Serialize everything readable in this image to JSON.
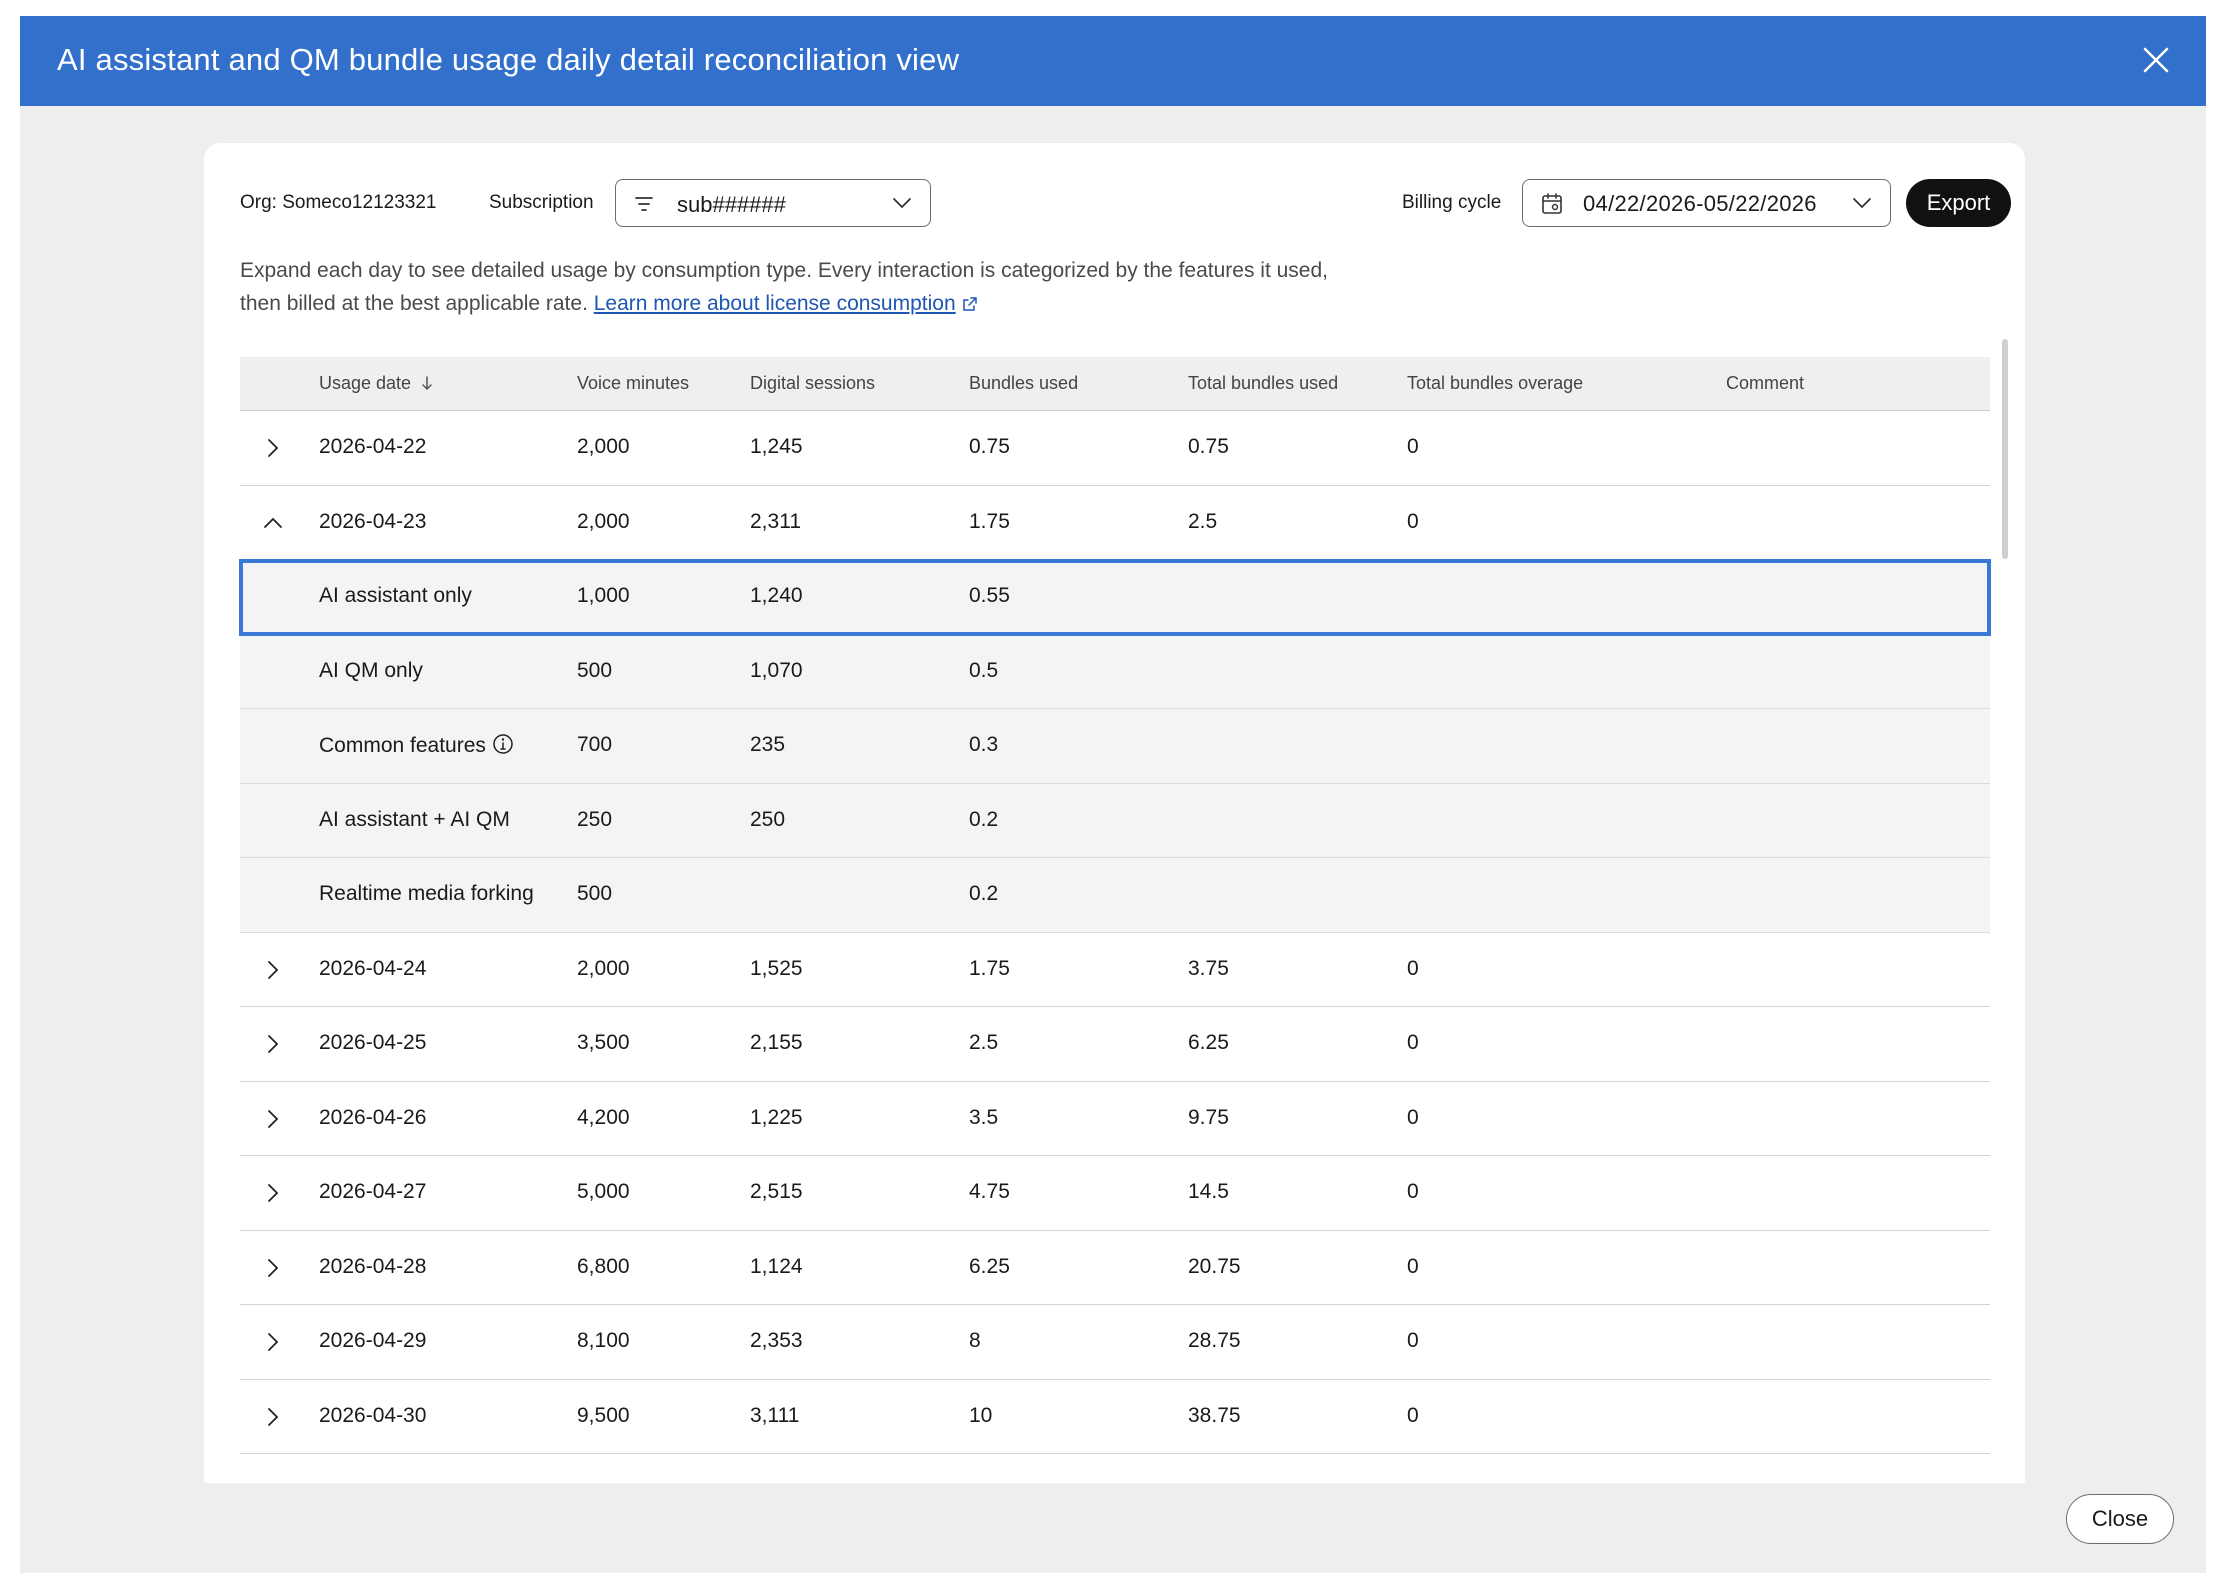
{
  "header": {
    "title": "AI assistant and QM bundle usage daily detail reconciliation view"
  },
  "filters": {
    "org": "Org: Someco12123321",
    "subscription_label": "Subscription",
    "subscription_value": "sub######",
    "billing_cycle_label": "Billing cycle",
    "billing_cycle_value": "04/22/2026-05/22/2026",
    "export_label": "Export"
  },
  "description": {
    "text": "Expand each day to see detailed usage by consumption type. Every interaction is categorized by the features it used, then billed at the best applicable rate.",
    "link": "Learn more about license consumption"
  },
  "table": {
    "columns": [
      "Usage date",
      "Voice minutes",
      "Digital sessions",
      "Bundles used",
      "Total bundles used",
      "Total bundles overage",
      "Comment"
    ],
    "rows": [
      {
        "date": "2026-04-22",
        "voice": "2,000",
        "digital": "1,245",
        "bundles": "0.75",
        "total": "0.75",
        "overage": "0",
        "comment": ""
      },
      {
        "date": "2026-04-23",
        "voice": "2,000",
        "digital": "2,311",
        "bundles": "1.75",
        "total": "2.5",
        "overage": "0",
        "comment": ""
      },
      {
        "date": "AI assistant only",
        "voice": "1,000",
        "digital": "1,240",
        "bundles": "0.55"
      },
      {
        "date": "AI QM only",
        "voice": "500",
        "digital": "1,070",
        "bundles": "0.5"
      },
      {
        "date": "Common features",
        "voice": "700",
        "digital": "235",
        "bundles": "0.3"
      },
      {
        "date": "AI assistant + AI QM",
        "voice": "250",
        "digital": "250",
        "bundles": "0.2"
      },
      {
        "date": "Realtime media forking",
        "voice": "500",
        "digital": "",
        "bundles": "0.2"
      },
      {
        "date": "2026-04-24",
        "voice": "2,000",
        "digital": "1,525",
        "bundles": "1.75",
        "total": "3.75",
        "overage": "0",
        "comment": ""
      },
      {
        "date": "2026-04-25",
        "voice": "3,500",
        "digital": "2,155",
        "bundles": "2.5",
        "total": "6.25",
        "overage": "0",
        "comment": ""
      },
      {
        "date": "2026-04-26",
        "voice": "4,200",
        "digital": "1,225",
        "bundles": "3.5",
        "total": "9.75",
        "overage": "0",
        "comment": ""
      },
      {
        "date": "2026-04-27",
        "voice": "5,000",
        "digital": "2,515",
        "bundles": "4.75",
        "total": "14.5",
        "overage": "0",
        "comment": ""
      },
      {
        "date": "2026-04-28",
        "voice": "6,800",
        "digital": "1,124",
        "bundles": "6.25",
        "total": "20.75",
        "overage": "0",
        "comment": ""
      },
      {
        "date": "2026-04-29",
        "voice": "8,100",
        "digital": "2,353",
        "bundles": "8",
        "total": "28.75",
        "overage": "0",
        "comment": ""
      },
      {
        "date": "2026-04-30",
        "voice": "9,500",
        "digital": "3,111",
        "bundles": "10",
        "total": "38.75",
        "overage": "0",
        "comment": ""
      }
    ]
  },
  "footer": {
    "close_label": "Close"
  },
  "colors": {
    "header": "#3270cc",
    "link": "#1d56b3",
    "focus": "#3a78d6"
  }
}
